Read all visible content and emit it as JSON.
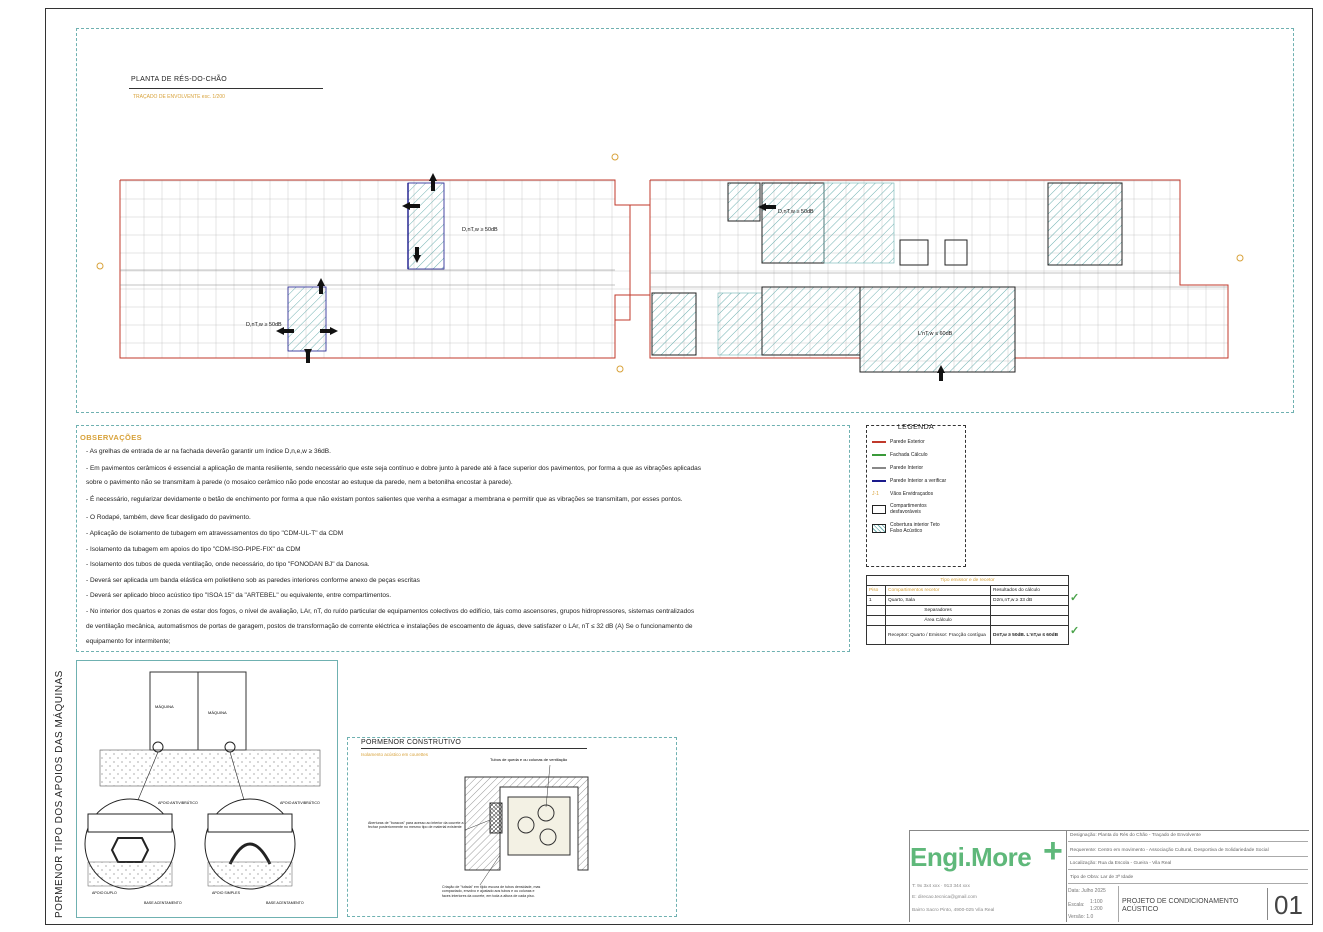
{
  "plan": {
    "title": "PLANTA DE RÉS-DO-CHÃO",
    "subtitle": "TRAÇADO DE ENVOLVENTE esc. 1/200",
    "labels": {
      "d_ntw_1": "D,nT,w ≥ 50dB",
      "d_ntw_2": "D,nT,w ≥ 50dB",
      "d_ntw_3": "D,nT,w ≥ 50dB",
      "l_ntw": "L'nT,w ≤ 60dB"
    }
  },
  "observations": {
    "title": "OBSERVAÇÕES",
    "items": [
      "- As grelhas de entrada de ar na fachada deverão garantir um índice D,n,e,w  ≥ 36dB.",
      "- Em pavimentos cerâmicos é essencial a aplicação de manta resiliente, sendo necessário que este seja contínuo e dobre junto à parede até à face superior dos pavimentos, por forma a que as vibrações aplicadas",
      "  sobre o pavimento não se transmitam à parede (o mosaico cerâmico não pode encostar ao estuque da parede, nem a betonilha encostar à parede).",
      "- É necessário, regularizar devidamente o betão de enchimento por forma a que não existam pontos salientes que venha a esmagar a membrana e permitir que as vibrações se transmitam, por esses pontos.",
      "- O Rodapé, também, deve ficar desligado do pavimento.",
      "- Aplicação de isolamento de tubagem em atravessamentos do tipo \"CDM-UL-T\" da CDM",
      "- Isolamento da tubagem em apoios do tipo \"CDM-ISO-PIPE-FIX\" da CDM",
      "- Isolamento dos tubos de queda ventilação, onde necessário, do tipo \"FONODAN BJ\" da Danosa.",
      "- Deverá ser aplicada um banda elástica em polietileno sob as paredes interiores conforme anexo de peças escritas",
      "- Deverá ser aplicado bloco acústico tipo \"ISOA 15\" da \"ARTEBEL\" ou equivalente, entre compartimentos.",
      "- No interior dos quartos e zonas de estar dos fogos, o nível de avaliação, LAr, nT, do ruído particular de equipamentos colectivos do edifício, tais como ascensores, grupos hidropressores, sistemas centralizados",
      "  de ventilação mecânica, automatismos de portas de garagem, postos de transformação de corrente eléctrica e instalações de escoamento de águas, deve satisfazer o LAr, nT ≤ 32 dB (A) Se o funcionamento de",
      "  equipamento for intermitente;"
    ]
  },
  "legend": {
    "title": "LEGENDA",
    "items": [
      {
        "label": "Parede Exterior",
        "color": "#c0392b",
        "kind": "line"
      },
      {
        "label": "Fachada Cálculo",
        "color": "#3a9a3a",
        "kind": "line"
      },
      {
        "label": "Parede Interior",
        "color": "#888888",
        "kind": "line"
      },
      {
        "label": "Parede Interior a verificar",
        "color": "#1a1a8c",
        "kind": "line"
      },
      {
        "label": "Vãos Envidraçados",
        "color": "#d8a23a",
        "kind": "text"
      },
      {
        "label": "Compartimentos desfavoráveis",
        "color": "#222222",
        "kind": "box"
      },
      {
        "label": "Cobertura interior Teto Falso Acústico",
        "color": "#6fb1b1",
        "kind": "hatch"
      }
    ]
  },
  "results_table": {
    "header": "Tipo emissor e de recetor",
    "columns": [
      "Piso",
      "Compartimentos recetor",
      "Resultados do cálculo"
    ],
    "rows": [
      {
        "piso": "1",
        "comp": "Quarto, Sala",
        "result": "D2m,nT,w ≥ 33 dB"
      },
      {
        "piso": "",
        "comp": "Separadores",
        "result": ""
      },
      {
        "piso": "",
        "comp": "Área Cálculo",
        "result": ""
      },
      {
        "piso": "",
        "comp": "Receptor: Quarto / Emissor: Fracção contígua",
        "result": "DnT,w ≥ 50dB. L'nT,w ≤ 60dB"
      }
    ]
  },
  "machine_detail": {
    "vertical_title": "PORMENOR TIPO DOS APOIOS DAS MÁQUINAS",
    "labels": {
      "maquina1": "MÁQUINA",
      "maquina2": "MÁQUINA",
      "apoio1": "APOIO ANTIVIBRÁTICO",
      "apoio2": "APOIO ANTIVIBRÁTICO",
      "apoio_duplo": "APOIO DUPLO",
      "apoio_simples": "APOIO SIMPLES",
      "base1": "BASE ACENTAMENTO",
      "base2": "BASE ACENTAMENTO"
    }
  },
  "construction_detail": {
    "title": "PORMENOR CONSTRUTIVO",
    "subtitle": "Isolamento acústico em courettes",
    "labels": {
      "tubos": "Tubos de queda e ou colunas de ventilação",
      "aberturas": "Aberturas de \"buracos\" para acesso ao interior da courete a fechar posteriormente no mesmo tipo de material existente",
      "criacao": "Criação de \"tufada\" em tijolo escura de tubos densidade, mas compactado, envolvo e ajustado aos tubos e ou colunas e faces interiores da courete, em toda a altura de cada piso."
    }
  },
  "title_block": {
    "logo": "Engi.More",
    "contact_lines": [
      "T: 9x 3x4 xxx · 913 344 xxx",
      "E: direcao.tecnica@gmail.com",
      "Bairro Sacro Pinto, 4900-025 Vila Real"
    ],
    "rows": [
      "Designação: Planta do Rés do Chão - Traçado de Envolvente",
      "Requerente: Centro em movimento - Associação Cultural, Desportiva de Solidariedade Social",
      "Localização: Rua da Escola - Gueira - Vila Real",
      "Tipo de Obra: Lar de 3ª Idade"
    ],
    "date": "Data: Julho 2025",
    "scale_label": "Escala:",
    "scale_values": [
      "1:100",
      "1:200"
    ],
    "version": "Versão: 1.0",
    "project_name": "PROJETO DE CONDICIONAMENTO ACÚSTICO",
    "sheet_number": "01"
  },
  "colors": {
    "exterior_wall": "#c0392b",
    "interior_wall": "#555555",
    "check_wall": "#1a1a8c",
    "hatch": "#6fb1b1",
    "accent": "#d8a23a",
    "brand": "#5fb87a"
  }
}
